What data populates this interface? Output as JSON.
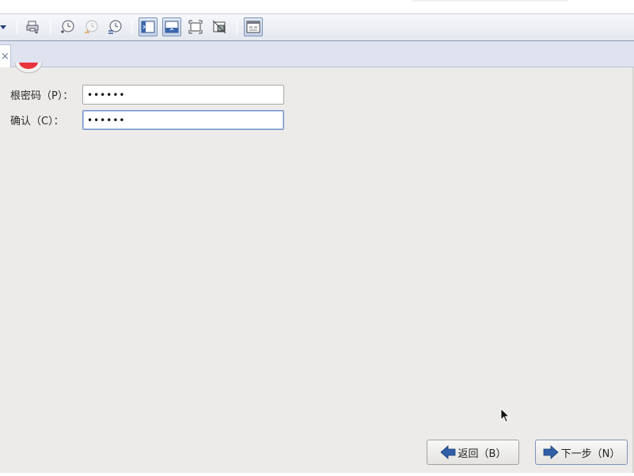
{
  "toolbar": {
    "icons": [
      "dropdown-arrow-icon",
      "printer-icon",
      "snapshot-take-icon",
      "snapshot-revert-icon",
      "snapshot-manager-icon",
      "show-sidebar-icon",
      "show-console-icon",
      "fullscreen-icon",
      "unity-icon",
      "thumbnail-view-icon"
    ]
  },
  "tab": {
    "close_glyph": "×"
  },
  "form": {
    "root_password_label": "根密码（P）：",
    "root_password_value": "••••••",
    "confirm_label": "确认（C）：",
    "confirm_value": "••••••"
  },
  "buttons": {
    "back_label": "返回（B）",
    "next_label": "下一步（N）"
  },
  "colors": {
    "background": "#ecebe9",
    "toolbar": "#e3e7ee",
    "tabstrip": "#dfe3f0",
    "focus_border": "#7291c6",
    "arrow_blue": "#2f5fa7"
  }
}
